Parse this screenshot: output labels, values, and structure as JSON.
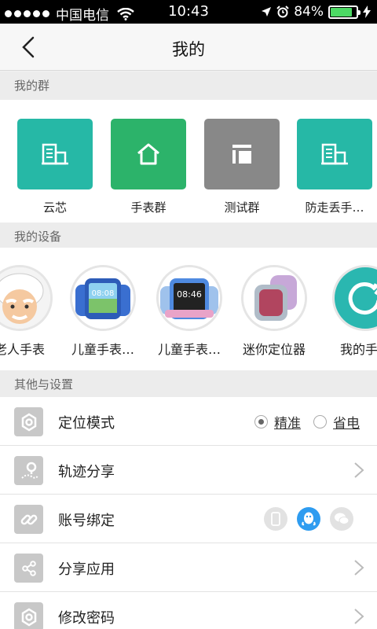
{
  "status_bar": {
    "carrier": "中国电信",
    "time": "10:43",
    "battery": "84%",
    "battery_level": 0.84
  },
  "nav": {
    "title": "我的",
    "back_icon": "chevron-left-icon"
  },
  "my_groups": {
    "header": "我的群",
    "items": [
      {
        "label": "云芯",
        "color": "#26b8a6",
        "icon": "building-icon"
      },
      {
        "label": "手表群",
        "color": "#2cb36a",
        "icon": "home-icon"
      },
      {
        "label": "测试群",
        "color": "#888888",
        "icon": "layout-icon"
      },
      {
        "label": "防走丢手…",
        "color": "#26b8a6",
        "icon": "building-icon"
      }
    ]
  },
  "my_devices": {
    "header": "我的设备",
    "items": [
      {
        "label": "老人手表",
        "image": "elderly-avatar"
      },
      {
        "label": "儿童手表…",
        "image": "kids-watch-blue",
        "watch_time": "08:08"
      },
      {
        "label": "儿童手表…",
        "image": "kids-watch-pink",
        "watch_time": "08:46"
      },
      {
        "label": "迷你定位器",
        "image": "mini-locator"
      },
      {
        "label": "我的手表",
        "image": "app-logo"
      }
    ]
  },
  "settings": {
    "header": "其他与设置",
    "location_mode": {
      "label": "定位模式",
      "options": [
        "精准",
        "省电"
      ],
      "selected": "精准"
    },
    "track_share": {
      "label": "轨迹分享"
    },
    "account_binding": {
      "label": "账号绑定",
      "bound": "qq-icon"
    },
    "share_app": {
      "label": "分享应用"
    },
    "change_password": {
      "label": "修改密码"
    }
  },
  "colors": {
    "accent_blue": "#2e9cf0",
    "teal": "#26b8a6",
    "green": "#2cb36a",
    "battery_green": "#4cd964"
  }
}
